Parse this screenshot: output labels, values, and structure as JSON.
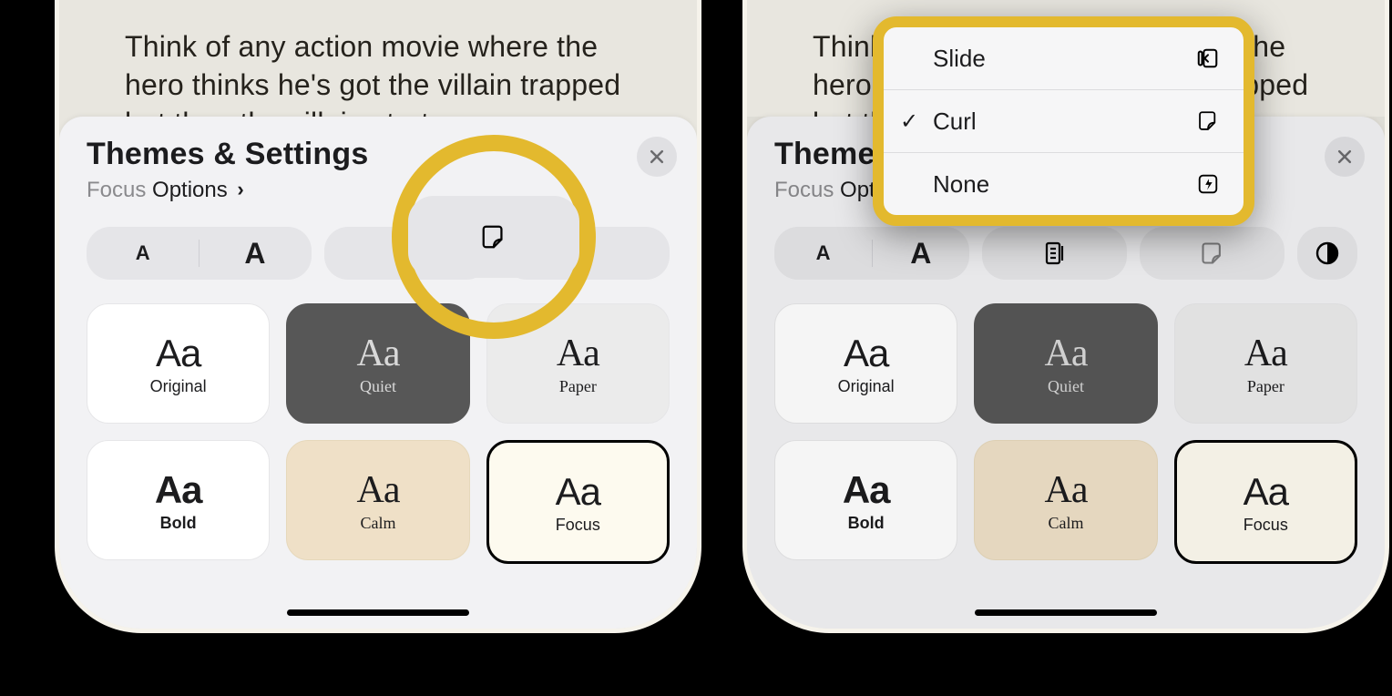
{
  "reader_snippet": "Think of any action movie where the hero thinks he's got the villain trapped  but then the villain starts",
  "sheet": {
    "title": "Themes & Settings",
    "subtitle_theme": "Focus",
    "subtitle_link": "Options"
  },
  "toolbar": {
    "font_small": "A",
    "font_large": "A"
  },
  "themes": [
    {
      "label": "Original",
      "key": "original"
    },
    {
      "label": "Quiet",
      "key": "quiet"
    },
    {
      "label": "Paper",
      "key": "paper"
    },
    {
      "label": "Bold",
      "key": "bold"
    },
    {
      "label": "Calm",
      "key": "calm"
    },
    {
      "label": "Focus",
      "key": "focus"
    }
  ],
  "menu": [
    {
      "label": "Slide",
      "icon": "slide",
      "selected": false
    },
    {
      "label": "Curl",
      "icon": "curl",
      "selected": true
    },
    {
      "label": "None",
      "icon": "bolt",
      "selected": false
    }
  ],
  "highlight_gold": "#e3b92e"
}
